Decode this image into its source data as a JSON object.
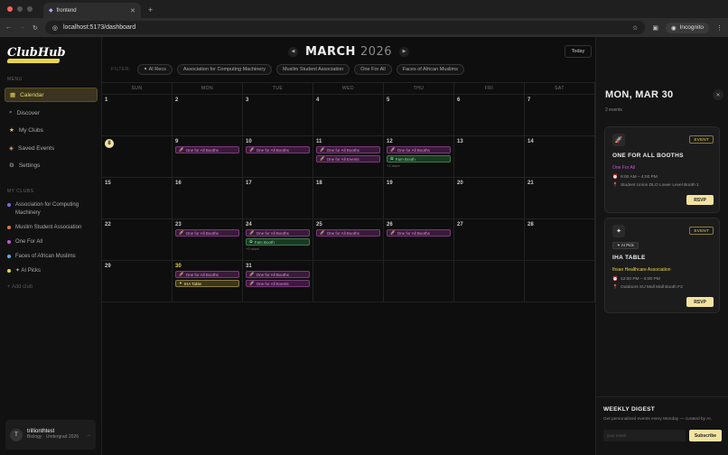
{
  "browser": {
    "tab_title": "frontend",
    "url": "localhost:5173/dashboard",
    "incognito_label": "Incognito"
  },
  "sidebar": {
    "logo": "ClubHub",
    "menu_label": "MENU",
    "items": [
      {
        "label": "Calendar",
        "icon": "calendar-icon"
      },
      {
        "label": "Discover",
        "icon": "search-icon"
      },
      {
        "label": "My Clubs",
        "icon": "star-icon"
      },
      {
        "label": "Saved Events",
        "icon": "tag-icon"
      },
      {
        "label": "Settings",
        "icon": "gear-icon"
      }
    ],
    "clubs_label": "MY CLUBS",
    "clubs": [
      {
        "label": "Association for Computing Machinery",
        "color": "#7a6ae0"
      },
      {
        "label": "Muslim Student Association",
        "color": "#e07a3a"
      },
      {
        "label": "One For All",
        "color": "#c05ad0"
      },
      {
        "label": "Faces of African Muslims",
        "color": "#5ab0e0"
      },
      {
        "label": "✦ AI Picks",
        "color": "#e8d44a"
      }
    ],
    "add_club": "+ Add club",
    "user": {
      "initial": "T",
      "name": "trillionthtest",
      "sub": "Biology · Undergrad 2026"
    }
  },
  "calendar": {
    "month": "MARCH",
    "year": "2026",
    "today_button": "Today",
    "filter_label": "FILTER:",
    "filters": [
      "✦ AI Recs",
      "Association for Computing Machinery",
      "Muslim Student Association",
      "One For All",
      "Faces of African Muslims"
    ],
    "dow": [
      "SUN",
      "MON",
      "TUE",
      "WED",
      "THU",
      "FRI",
      "SAT"
    ],
    "weeks": [
      [
        {
          "d": "1"
        },
        {
          "d": "2"
        },
        {
          "d": "3"
        },
        {
          "d": "4"
        },
        {
          "d": "5"
        },
        {
          "d": "6"
        },
        {
          "d": "7"
        }
      ],
      [
        {
          "d": "8",
          "today": true
        },
        {
          "d": "9",
          "ev": [
            [
              "purple",
              "One for All Booths"
            ]
          ]
        },
        {
          "d": "10",
          "ev": [
            [
              "purple",
              "One for All Booths"
            ]
          ]
        },
        {
          "d": "11",
          "ev": [
            [
              "purple",
              "One for All Booths"
            ],
            [
              "purple",
              "One for All Events"
            ]
          ]
        },
        {
          "d": "12",
          "ev": [
            [
              "purple",
              "One for All Booths"
            ],
            [
              "green",
              "Fam Booth"
            ]
          ],
          "more": "+1 more"
        },
        {
          "d": "13"
        },
        {
          "d": "14"
        }
      ],
      [
        {
          "d": "15"
        },
        {
          "d": "16"
        },
        {
          "d": "17"
        },
        {
          "d": "18"
        },
        {
          "d": "19"
        },
        {
          "d": "20"
        },
        {
          "d": "21"
        }
      ],
      [
        {
          "d": "22"
        },
        {
          "d": "23",
          "ev": [
            [
              "purple",
              "One for All Booths"
            ]
          ]
        },
        {
          "d": "24",
          "ev": [
            [
              "purple",
              "One for All Booths"
            ],
            [
              "green",
              "Fam Booth"
            ]
          ],
          "more": "+3 more"
        },
        {
          "d": "25",
          "ev": [
            [
              "purple",
              "One for All Booths"
            ]
          ]
        },
        {
          "d": "26",
          "ev": [
            [
              "purple",
              "One for All Booths"
            ]
          ]
        },
        {
          "d": "27"
        },
        {
          "d": "28"
        }
      ],
      [
        {
          "d": "29"
        },
        {
          "d": "30",
          "sel": true,
          "ev": [
            [
              "purple",
              "One for All Booths"
            ],
            [
              "gold",
              "IHA Table"
            ]
          ]
        },
        {
          "d": "31",
          "ev": [
            [
              "purple",
              "One for All Booths"
            ],
            [
              "purple",
              "One for All Events"
            ]
          ]
        },
        {
          "d": ""
        },
        {
          "d": ""
        },
        {
          "d": ""
        },
        {
          "d": ""
        }
      ]
    ]
  },
  "panel": {
    "title": "MON, MAR 30",
    "subtitle": "2 events",
    "events": [
      {
        "icon": "🚀",
        "badge": "EVENT",
        "title": "ONE FOR ALL BOOTHS",
        "org": "One For All",
        "org_color": "#c05ad0",
        "time": "9:00 AM – 4:00 PM",
        "location": "Student Union DLO Lower Level Booth 1",
        "rsvp": "RSVP"
      },
      {
        "icon": "✦",
        "badge": "EVENT",
        "ai": "✦ AI Pick",
        "title": "IHA TABLE",
        "org": "Ihsan Healthcare Association",
        "org_color": "#e8d44a",
        "time": "12:00 PM – 6:00 PM",
        "location": "Outdoors SU Mall Mall Booth F2",
        "rsvp": "RSVP"
      }
    ],
    "digest": {
      "title": "WEEKLY DIGEST",
      "text": "Get personalized events every Monday — curated by AI.",
      "placeholder": "your email",
      "button": "Subscribe"
    }
  }
}
